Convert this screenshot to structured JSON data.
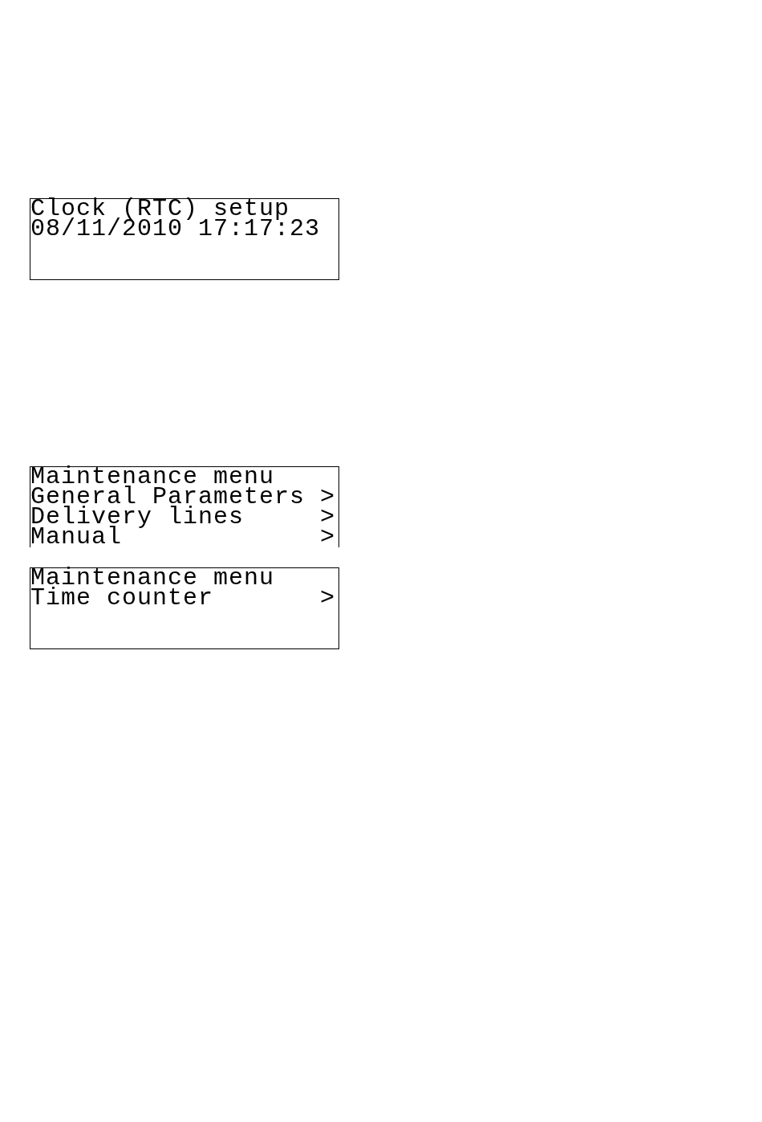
{
  "screens": [
    {
      "title": "Clock (RTC) setup",
      "cropped": false,
      "rows": [
        {
          "kind": "value",
          "label": "08/11/2010 17:17:23"
        }
      ]
    },
    {
      "title": "Maintenance menu",
      "cropped": true,
      "rows": [
        {
          "kind": "menu",
          "label": "General Parameters",
          "arrow": ">"
        },
        {
          "kind": "menu",
          "label": "Delivery lines",
          "arrow": ">"
        },
        {
          "kind": "menu",
          "label": "Manual",
          "arrow": ">"
        }
      ]
    },
    {
      "title": "Maintenance menu",
      "cropped": false,
      "rows": [
        {
          "kind": "menu",
          "label": "Time counter",
          "arrow": ">"
        }
      ]
    }
  ]
}
